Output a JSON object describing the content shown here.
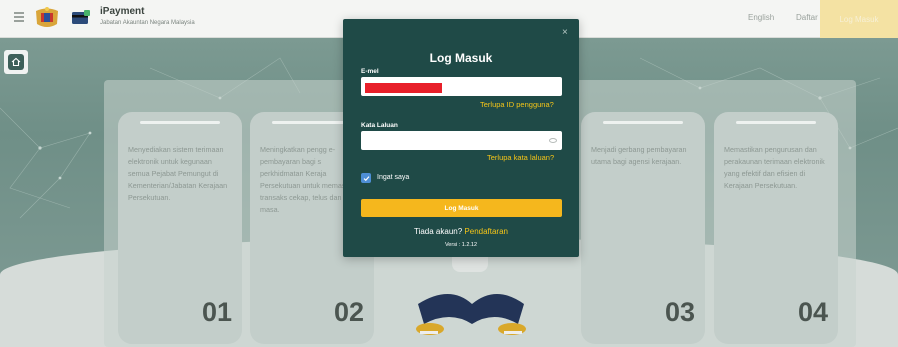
{
  "header": {
    "app_name": "iPayment",
    "agency": "Jabatan Akauntan Negara Malaysia",
    "language_link": "English",
    "register_link": "Daftar",
    "login_button": "Log Masuk"
  },
  "features": [
    {
      "text": "Menyediakan sistem terimaan elektronik untuk kegunaan semua Pejabat Pemungut di Kementerian/Jabatan Kerajaan Persekutuan.",
      "number": "01"
    },
    {
      "text": "Meningkatkan pengg e-pembayaran bagi s perkhidmatan Keraja Persekutuan untuk memastikan transaks cekap, telus dan tep masa.",
      "number": "02"
    },
    {
      "text": "Menjadi gerbang pembayaran utama bagi agensi kerajaan.",
      "number": "03"
    },
    {
      "text": "Memastikan pengurusan dan perakaunan terimaan elektronik yang efektif dan efisien di Kerajaan Persekutuan.",
      "number": "04"
    }
  ],
  "login_modal": {
    "title": "Log Masuk",
    "email_label": "E-mel",
    "forgot_id": "Terlupa ID pengguna?",
    "password_label": "Kata Laluan",
    "forgot_password": "Terlupa kata laluan?",
    "remember_me": "Ingat saya",
    "submit": "Log Masuk",
    "no_account": "Tiada akaun?",
    "register": "Pendaftaran",
    "version": "Versi : 1.2.12",
    "close_icon": "close-icon"
  },
  "colors": {
    "modal_bg": "#1f4a47",
    "accent": "#f5b71d",
    "link": "#f5c518",
    "redaction": "#e8202a"
  }
}
